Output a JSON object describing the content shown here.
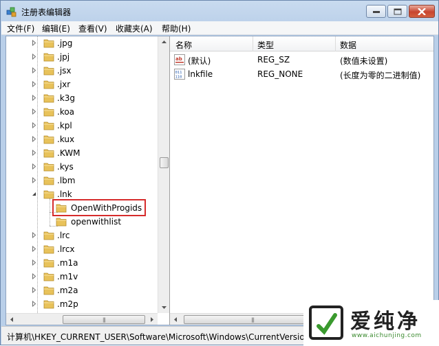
{
  "window": {
    "title": "注册表编辑器",
    "icon": "regedit-icon"
  },
  "menu": [
    "文件(F)",
    "编辑(E)",
    "查看(V)",
    "收藏夹(A)",
    "帮助(H)"
  ],
  "tree": {
    "items": [
      {
        "label": ".jpg",
        "level": 0,
        "expander": "collapsed"
      },
      {
        "label": ".jpj",
        "level": 0,
        "expander": "collapsed"
      },
      {
        "label": ".jsx",
        "level": 0,
        "expander": "collapsed"
      },
      {
        "label": ".jxr",
        "level": 0,
        "expander": "collapsed"
      },
      {
        "label": ".k3g",
        "level": 0,
        "expander": "collapsed"
      },
      {
        "label": ".koa",
        "level": 0,
        "expander": "collapsed"
      },
      {
        "label": ".kpl",
        "level": 0,
        "expander": "collapsed"
      },
      {
        "label": ".kux",
        "level": 0,
        "expander": "collapsed"
      },
      {
        "label": ".KWM",
        "level": 0,
        "expander": "collapsed"
      },
      {
        "label": ".kys",
        "level": 0,
        "expander": "collapsed"
      },
      {
        "label": ".lbm",
        "level": 0,
        "expander": "collapsed"
      },
      {
        "label": ".lnk",
        "level": 0,
        "expander": "expanded"
      },
      {
        "label": "OpenWithProgids",
        "level": 1,
        "expander": "none",
        "selected": true
      },
      {
        "label": "openwithlist",
        "level": 1,
        "expander": "none"
      },
      {
        "label": ".lrc",
        "level": 0,
        "expander": "collapsed"
      },
      {
        "label": ".lrcx",
        "level": 0,
        "expander": "collapsed"
      },
      {
        "label": ".m1a",
        "level": 0,
        "expander": "collapsed"
      },
      {
        "label": ".m1v",
        "level": 0,
        "expander": "collapsed"
      },
      {
        "label": ".m2a",
        "level": 0,
        "expander": "collapsed"
      },
      {
        "label": ".m2p",
        "level": 0,
        "expander": "collapsed"
      }
    ]
  },
  "list": {
    "columns": [
      "名称",
      "类型",
      "数据"
    ],
    "rows": [
      {
        "icon": "string-value-icon",
        "name": "(默认)",
        "type": "REG_SZ",
        "data": "(数值未设置)"
      },
      {
        "icon": "binary-value-icon",
        "name": "lnkfile",
        "type": "REG_NONE",
        "data": "(长度为零的二进制值)"
      }
    ]
  },
  "status": {
    "path": "计算机\\HKEY_CURRENT_USER\\Software\\Microsoft\\Windows\\CurrentVersion"
  },
  "watermark": {
    "name": "爱纯净",
    "url": "www.aichunjing.com"
  },
  "colors": {
    "highlight": "#d62b2b",
    "folder": "#e8c25a",
    "close_button": "#c7452f"
  }
}
